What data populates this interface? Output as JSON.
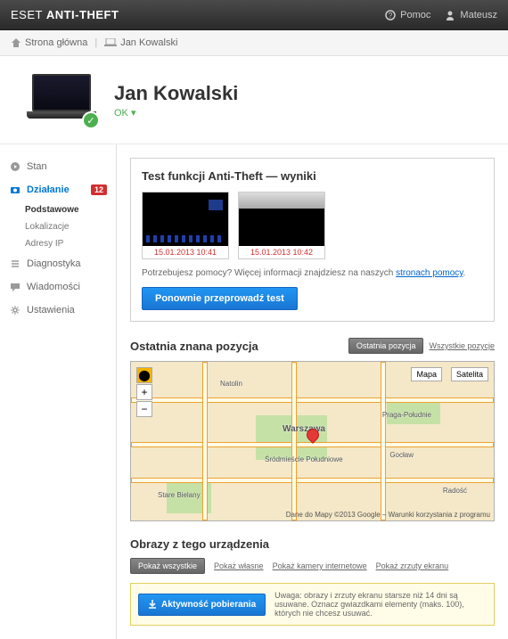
{
  "brand": {
    "prefix": "ESET",
    "suffix": "ANTI-THEFT"
  },
  "topbar": {
    "help": "Pomoc",
    "user": "Mateusz"
  },
  "breadcrumb": {
    "home": "Strona główna",
    "device": "Jan Kowalski"
  },
  "device": {
    "name": "Jan Kowalski",
    "status": "OK ▾"
  },
  "sidebar": {
    "state": "Stan",
    "activity": "Działanie",
    "activity_badge": "12",
    "sub_basic": "Podstawowe",
    "sub_loc": "Lokalizacje",
    "sub_ip": "Adresy IP",
    "diag": "Diagnostyka",
    "msg": "Wiadomości",
    "settings": "Ustawienia"
  },
  "test": {
    "title": "Test funkcji Anti-Theft — wyniki",
    "thumb1_ts": "15.01.2013 10:41",
    "thumb2_ts": "15.01.2013 10:42",
    "help_prefix": "Potrzebujesz pomocy? Więcej informacji znajdziesz na naszych ",
    "help_link": "stronach pomocy",
    "retest": "Ponownie przeprowadź test"
  },
  "location": {
    "title": "Ostatnia znana pozycja",
    "btn_last": "Ostatnia pozycja",
    "btn_all": "Wszystkie pozycje",
    "map_btn": "Mapa",
    "sat_btn": "Satelita",
    "city": "Warszawa",
    "district": "Śródmieście Południowe",
    "l_natolin": "Natolin",
    "l_stare": "Stare Bielany",
    "l_praga": "Praga-Południe",
    "l_goclaw": "Gocław",
    "l_radosc": "Radość",
    "attrib": "Dane do Mapy ©2013 Google – Warunki korzystania z programu"
  },
  "images": {
    "title": "Obrazy z tego urządzenia",
    "filter_all": "Pokaż wszystkie",
    "filter_own": "Pokaż własne",
    "filter_webcam": "Pokaż kamery internetowe",
    "filter_screen": "Pokaż zrzuty ekranu",
    "download": "Aktywność pobierania",
    "warning": "Uwaga: obrazy i zrzuty ekranu starsze niż 14 dni są usuwane. Oznacz gwiazdkami elementy (maks. 100), których nie chcesz usuwać."
  }
}
